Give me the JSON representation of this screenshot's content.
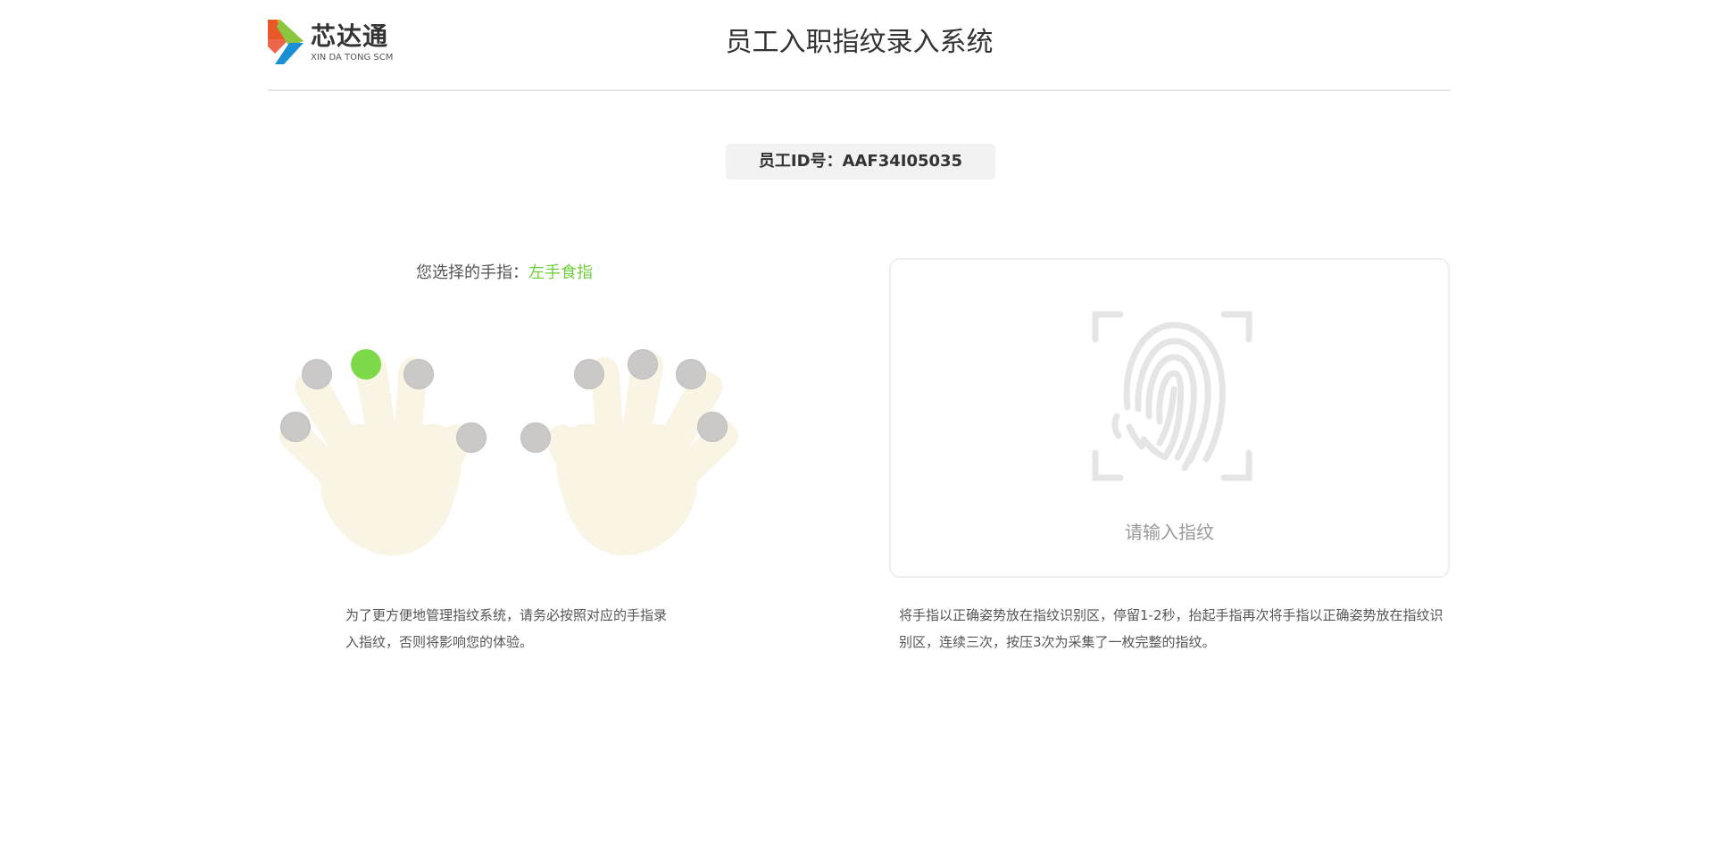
{
  "header": {
    "logo_cn": "芯达通",
    "logo_en": "XIN DA TONG SCM",
    "title": "员工入职指纹录入系统"
  },
  "employee": {
    "id_text": "员工ID号：AAF34I05035"
  },
  "finger_select": {
    "prompt_label": "您选择的手指：",
    "selected_finger": "左手食指",
    "description": "为了更方便地管理指纹系统，请务必按照对应的手指录入指纹，否则将影响您的体验。"
  },
  "scanner": {
    "hint": "请输入指纹",
    "description": "将手指以正确姿势放在指纹识别区，停留1-2秒，抬起手指再次将手指以正确姿势放在指纹识别区，连续三次，按压3次为采集了一枚完整的指纹。"
  },
  "colors": {
    "accent_green": "#6fcf3a",
    "dot_active": "#7dd94a",
    "dot_idle": "#cbc9c8",
    "hand_fill": "#faf4e4",
    "fingerprint_gray": "#e5e5e5"
  },
  "icons": {
    "logo": "play-triangle-logo-icon",
    "scanner": "fingerprint-scan-icon"
  }
}
